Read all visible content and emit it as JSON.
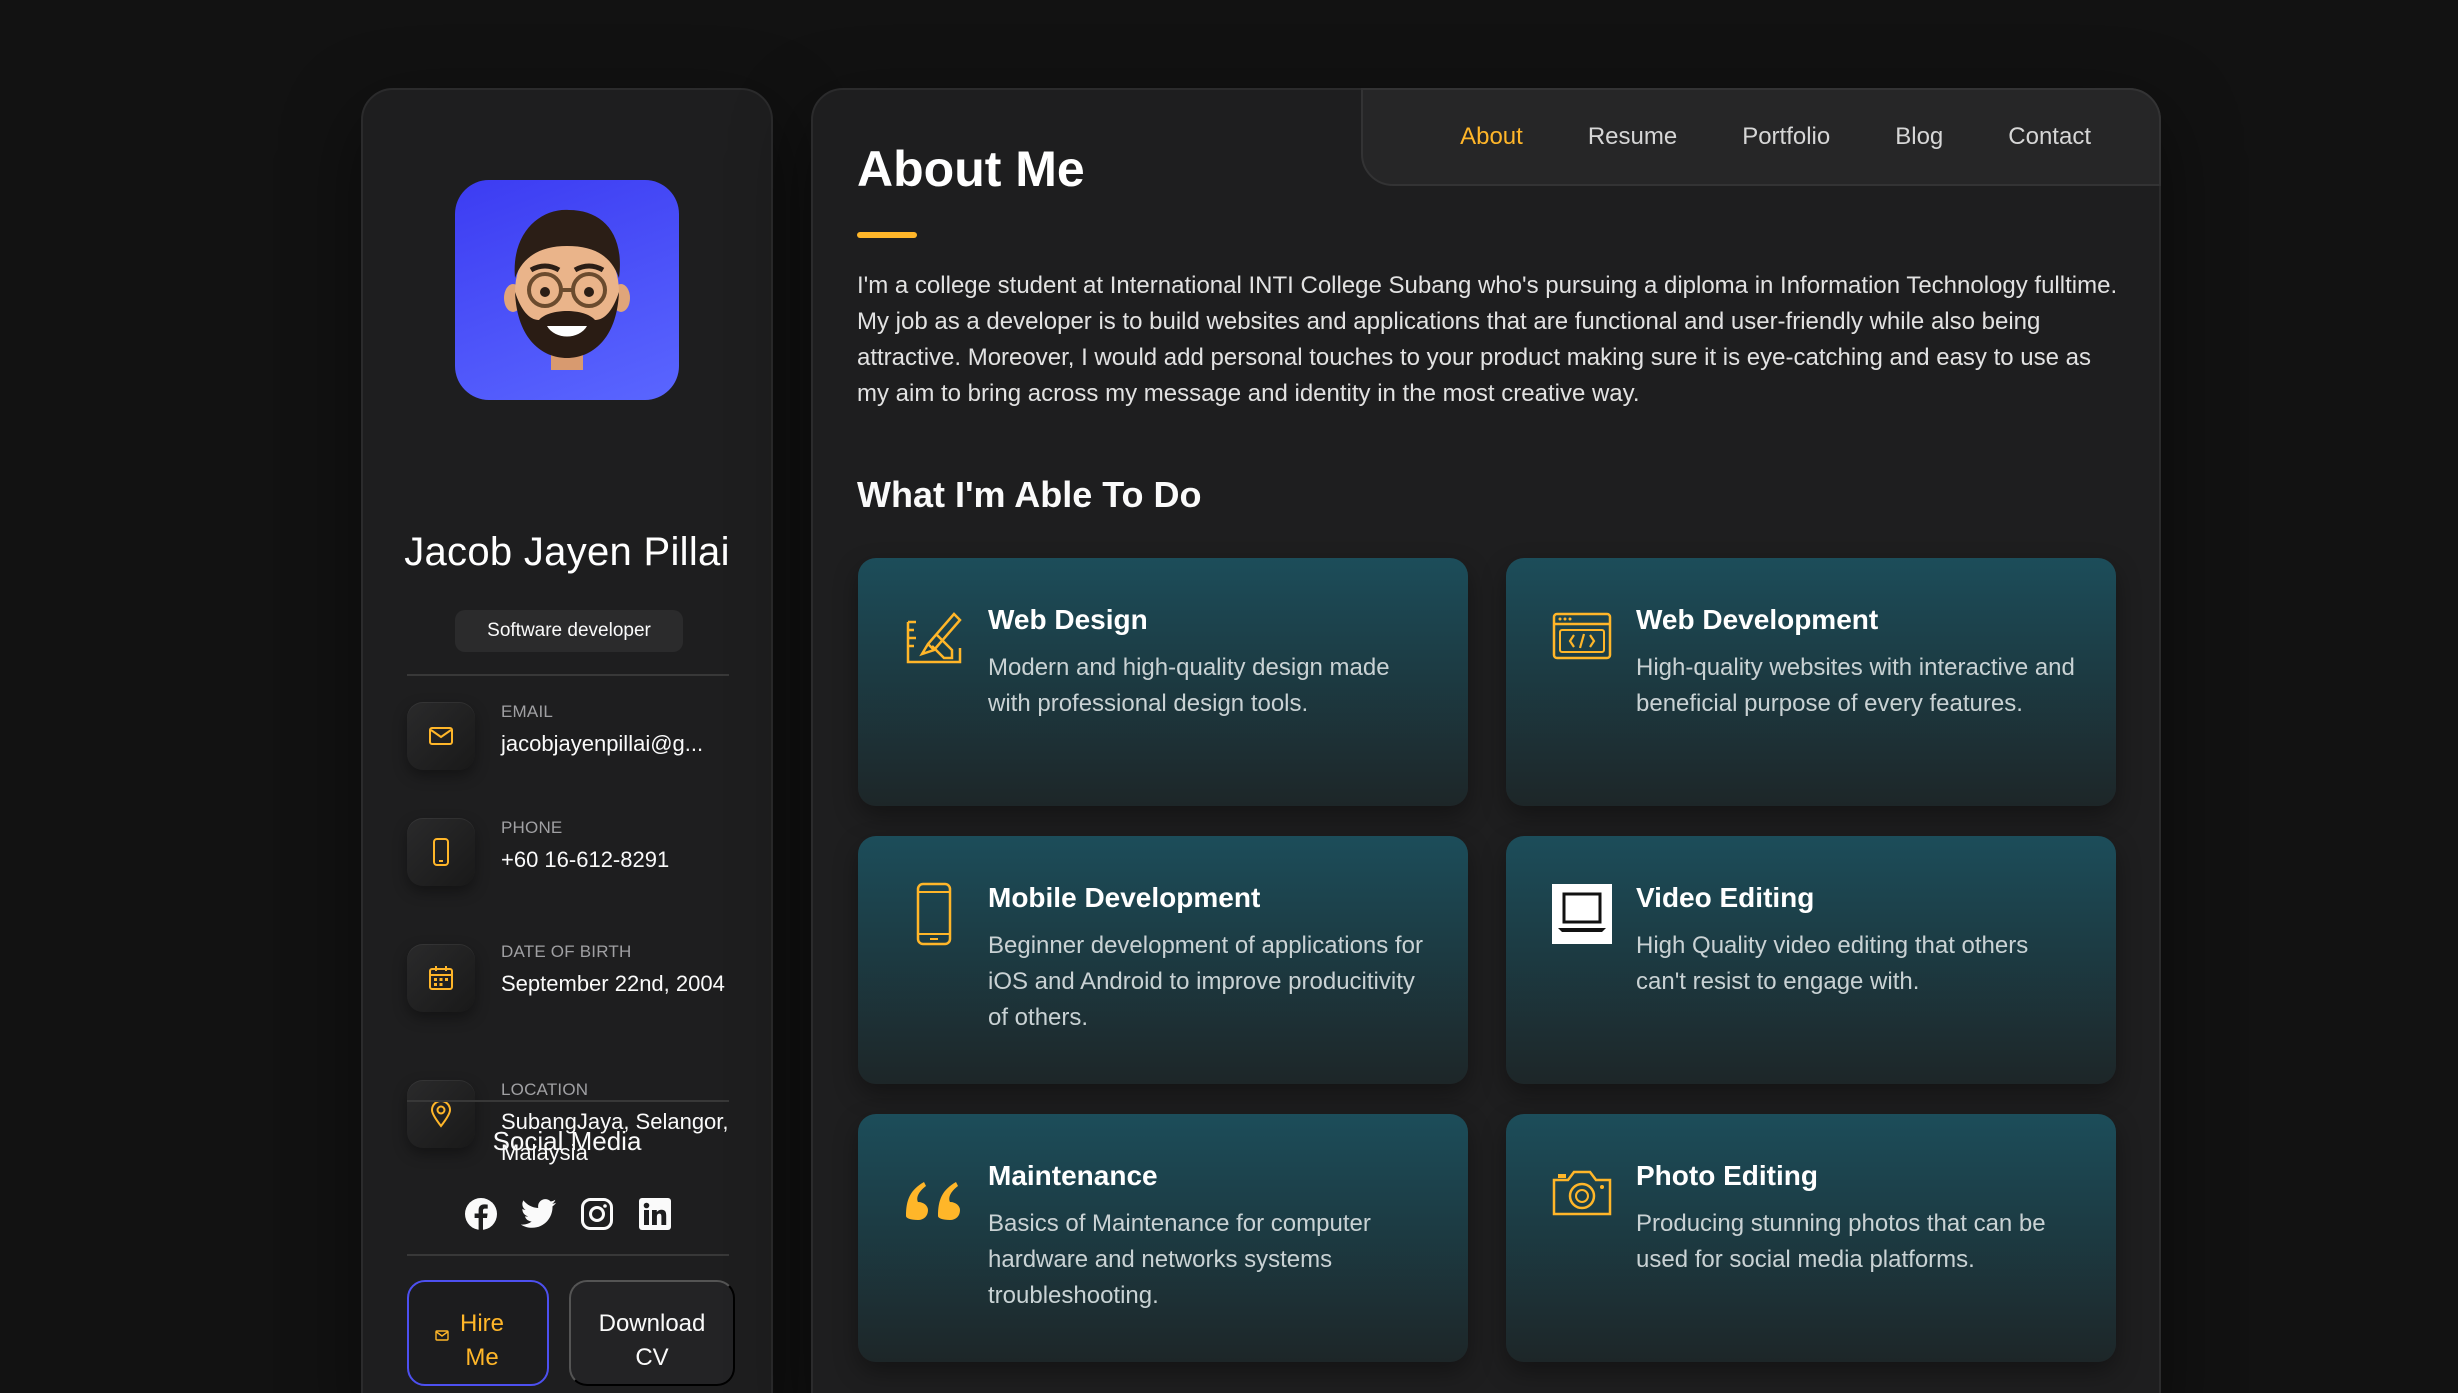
{
  "profile": {
    "name": "Jacob Jayen Pillai",
    "title": "Software developer"
  },
  "contacts": [
    {
      "label": "Email",
      "value": "jacobjayenpillai@g...",
      "icon": "mail-icon"
    },
    {
      "label": "Phone",
      "value": "+60 16-612-8291",
      "icon": "phone-icon"
    },
    {
      "label": "Date of Birth",
      "value": "September 22nd, 2004",
      "icon": "calendar-icon"
    },
    {
      "label": "Location",
      "value": "SubangJaya, Selangor, Malaysia",
      "icon": "location-pin-icon"
    }
  ],
  "social": {
    "title": "Social Media",
    "icons": [
      "facebook-icon",
      "twitter-icon",
      "instagram-icon",
      "linkedin-icon"
    ]
  },
  "buttons": {
    "hire": "Hire Me",
    "cv": "Download CV"
  },
  "nav": {
    "items": [
      "About",
      "Resume",
      "Portfolio",
      "Blog",
      "Contact"
    ],
    "active": "About"
  },
  "about": {
    "title": "About Me",
    "text": "I'm a college student at International INTI College Subang who's pursuing a diploma in Information Technology fulltime. My job as a developer is to build websites and applications that are functional and user-friendly while also being attractive. Moreover, I would add personal touches to your product making sure it is eye-catching and easy to use as my aim to bring across my message and identity in the most creative way."
  },
  "services": {
    "title": "What I'm Able To Do",
    "items": [
      {
        "title": "Web Design",
        "desc": "Modern and high-quality design made with professional design tools.",
        "icon": "design-tools-icon"
      },
      {
        "title": "Web Development",
        "desc": "High-quality websites with interactive and beneficial purpose of every features.",
        "icon": "code-window-icon"
      },
      {
        "title": "Mobile Development",
        "desc": "Beginner development of applications for iOS and Android to improve producitivity of others.",
        "icon": "smartphone-icon"
      },
      {
        "title": "Video Editing",
        "desc": "High Quality video editing that others can't resist to engage with.",
        "icon": "laptop-icon"
      },
      {
        "title": "Maintenance",
        "desc": "Basics of Maintenance for computer hardware and networks systems troubleshooting.",
        "icon": "quote-icon"
      },
      {
        "title": "Photo Editing",
        "desc": "Producing stunning photos that can be used for social media platforms.",
        "icon": "camera-icon"
      }
    ]
  },
  "colors": {
    "accent": "#ffb629",
    "background": "#121212",
    "card": "#1e1e1f",
    "hire_border": "#4d50f0"
  }
}
